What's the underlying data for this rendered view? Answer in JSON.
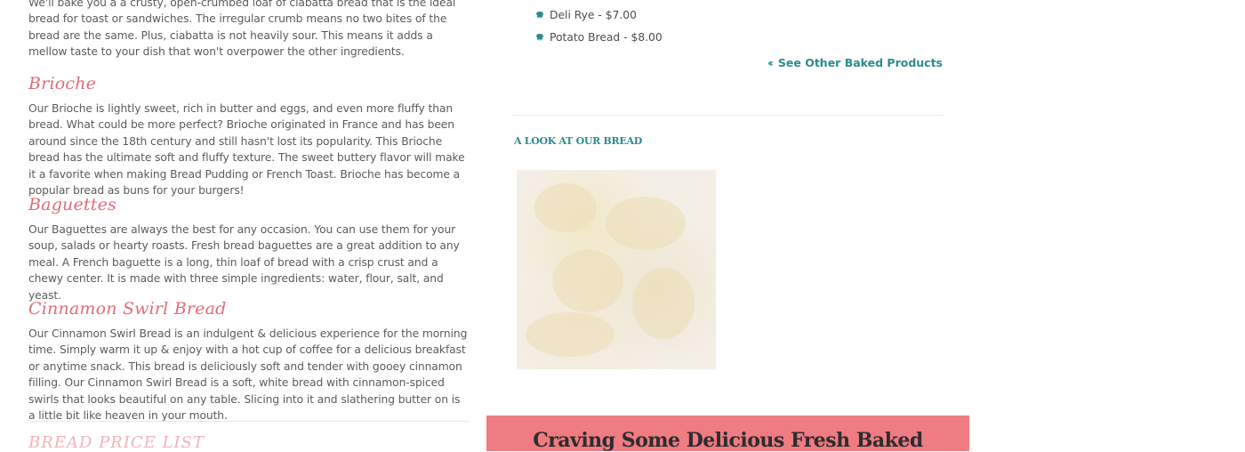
{
  "left": {
    "intro_paragraph": "We'll bake you a a crusty, open-crumbed loaf of ciabatta bread that is the ideal bread for toast or sandwiches. The irregular crumb means no two bites of the bread are the same. Plus, ciabatta is not heavily sour. This means it adds a mellow taste to your dish that won't overpower the other ingredients.",
    "sections": [
      {
        "title": "Brioche",
        "text": "Our Brioche is lightly sweet, rich in butter and eggs, and even more fluffy than bread. What could be more perfect? Brioche originated in France and has been around since the 18th century and still hasn't lost its popularity. This Brioche bread has the ultimate soft and fluffy texture. The sweet buttery flavor will make it a favorite when making Bread Pudding or French Toast. Brioche has become a popular bread as buns for your burgers!"
      },
      {
        "title": "Baguettes",
        "text": "Our Baguettes are always the best for any occasion. You can use them for your soup, salads or hearty roasts. Fresh bread baguettes are a great addition to any meal. A French baguette is a long, thin loaf of bread with a crisp crust and a chewy center. It is made with three simple ingredients: water, flour, salt, and yeast."
      },
      {
        "title": "Cinnamon Swirl Bread",
        "text": "Our Cinnamon Swirl Bread is an indulgent & delicious experience for the morning time. Simply warm it up & enjoy with a hot cup of coffee for a delicious breakfast or anytime snack. This bread is deliciously soft and tender with gooey cinnamon filling. Our Cinnamon Swirl Bread is a soft, white bread with cinnamon-spiced swirls that looks beautiful on any table. Slicing into it and slathering butter on is a little bit like heaven in your mouth."
      }
    ],
    "price_list_title": "BREAD PRICE LIST"
  },
  "right": {
    "price_items": [
      {
        "label": "Deli Rye - $7.00",
        "icon": "bakery-hat-icon"
      },
      {
        "label": "Potato Bread - $8.00",
        "icon": "bakery-hat-icon"
      }
    ],
    "see_other_label": "See Other Baked Products",
    "look_title": "A LOOK AT OUR BREAD",
    "banner_text": "Craving Some Delicious Fresh Baked"
  },
  "colors": {
    "heading_pink": "#e06d78",
    "teal": "#2b8b8f",
    "banner_pink": "#ef7b83"
  }
}
